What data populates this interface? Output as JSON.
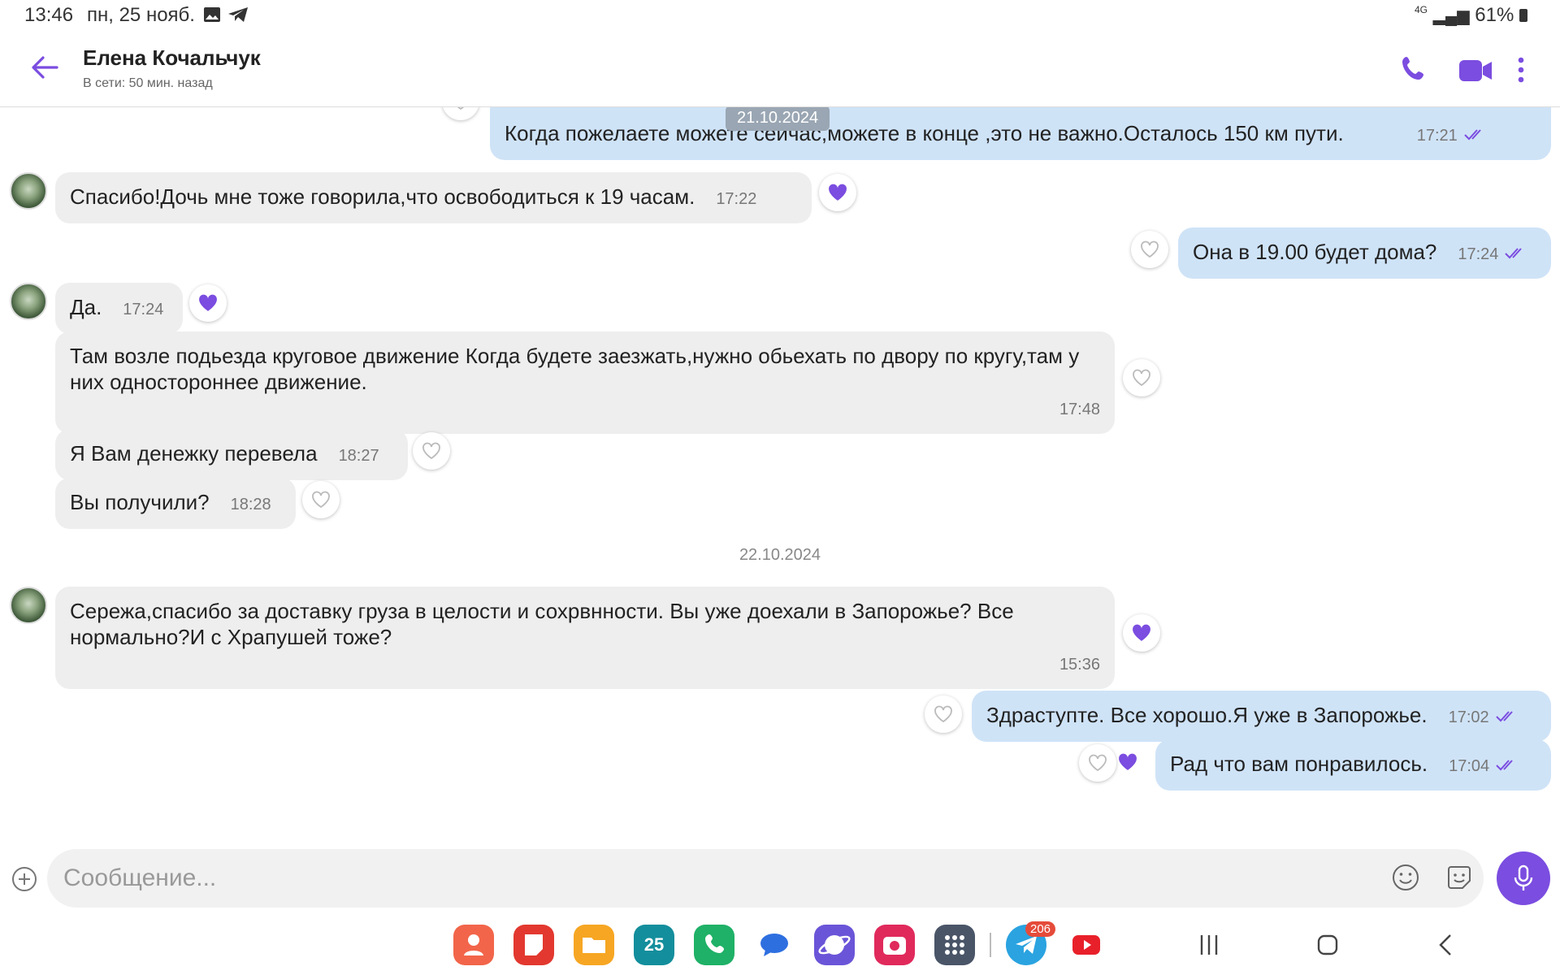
{
  "status_bar": {
    "time": "13:46",
    "date": "пн, 25 нояб.",
    "network": "4G",
    "battery": "61%"
  },
  "header": {
    "contact_name": "Елена Кочальчук",
    "last_seen": "В сети: 50 мин. назад"
  },
  "messages": [
    {
      "dir": "out",
      "text": "Когда пожелаете можете сейчас,можете в конце ,это не важно.Осталось 150 км пути.",
      "time": "17:21",
      "date_chip": "21.10.2024"
    },
    {
      "dir": "in",
      "text": "Спасибо!Дочь мне тоже говорила,что освободиться к 19 часам.",
      "time": "17:22",
      "liked": true
    },
    {
      "dir": "out",
      "text": "Она в 19.00 будет дома?",
      "time": "17:24"
    },
    {
      "dir": "in",
      "text": "Да.",
      "time": "17:24",
      "liked": true
    },
    {
      "dir": "in",
      "text": "Там возле подьезда круговое движение Когда будете заезжать,нужно обьехать по двору по кругу,там у них одностороннее движение.",
      "time": "17:48"
    },
    {
      "dir": "in",
      "text": "Я Вам денежку перевела",
      "time": "18:27"
    },
    {
      "dir": "in",
      "text": "Вы получили?",
      "time": "18:28"
    },
    {
      "dir": "in",
      "text": "Сережа,спасибо за доставку груза в целости и сохрвнности. Вы уже доехали в Запорожье? Все нормально?И с Храпушей тоже?",
      "time": "15:36",
      "liked": true
    },
    {
      "dir": "out",
      "text": "Здраступте. Все хорошо.Я уже в Запорожье.",
      "time": "17:02"
    },
    {
      "dir": "out",
      "text": "Рад что вам понравилось.",
      "time": "17:04",
      "liked": true
    }
  ],
  "date_separator": "22.10.2024",
  "composer": {
    "placeholder": "Сообщение..."
  },
  "dock": {
    "telegram_badge": "206",
    "calendar_day": "25"
  },
  "colors": {
    "accent": "#7b4de0",
    "outgoing": "#cfe3f7",
    "incoming": "#eeeeee"
  }
}
